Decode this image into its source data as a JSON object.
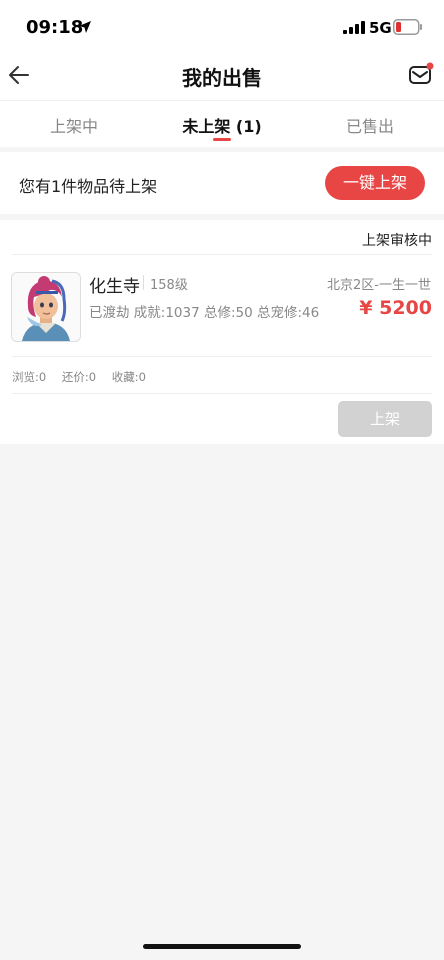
{
  "status_bar": {
    "time": "09:18",
    "network": "5G",
    "icons": [
      "location-arrow-icon",
      "signal-bars-icon",
      "battery-low-icon"
    ]
  },
  "nav": {
    "title": "我的出售",
    "back_icon": "back-arrow-icon",
    "mail_icon": "mail-icon",
    "mail_badge_color": "#e84545"
  },
  "tabs": [
    {
      "label": "上架中",
      "active": false
    },
    {
      "label": "未上架 (1)",
      "active": true
    },
    {
      "label": "已售出",
      "active": false
    }
  ],
  "banner": {
    "text": "您有1件物品待上架",
    "button_label": "一键上架"
  },
  "item": {
    "review_status": "上架审核中",
    "name": "化生寺",
    "level": "158级",
    "server": "北京2区-一生一世",
    "stats": "已渡劫 成就:1037 总修:50 总宠修:46",
    "price": "¥ 5200",
    "meta": {
      "views": "浏览:0",
      "bargains": "还价:0",
      "favorites": "收藏:0"
    },
    "list_button": "上架"
  },
  "colors": {
    "accent": "#e84545",
    "disabled_button": "#d2d2d2",
    "background": "#f5f5f5"
  }
}
